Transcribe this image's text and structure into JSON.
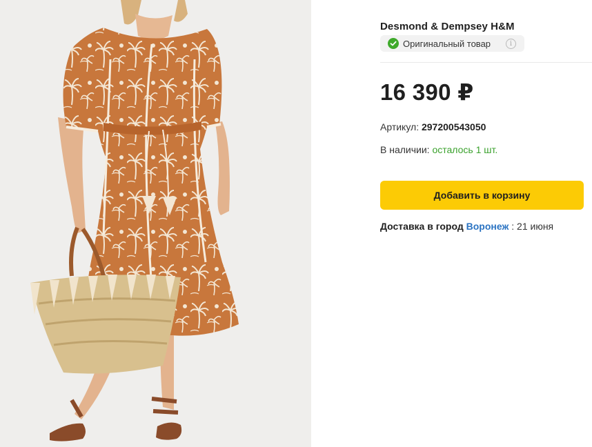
{
  "product": {
    "brand": "Desmond & Dempsey H&M",
    "original_badge": {
      "label": "Оригинальный товар",
      "icon": "check-circle-icon",
      "info_icon_glyph": "i",
      "accent_color": "#3faa2b"
    },
    "price": "16 390 ₽",
    "sku": {
      "label": "Артикул:",
      "value": "297200543050"
    },
    "stock": {
      "label": "В наличии:",
      "value": "осталось 1 шт.",
      "color": "#3aa12c"
    },
    "cart_button": {
      "label": "Добавить в корзину",
      "color": "#fccb05"
    },
    "delivery": {
      "label": "Доставка в город",
      "city": "Воронеж",
      "separator": ":",
      "date": "21 июня",
      "city_color": "#2a73c2"
    }
  }
}
